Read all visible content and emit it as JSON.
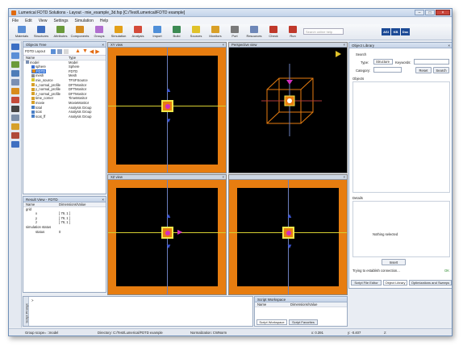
{
  "window": {
    "title": "Lumerical FDTD Solutions - Layout - mie_example_3d.fsp [C:/Test/Lumerical/FDTD example]",
    "controls": [
      "–",
      "□",
      "×"
    ]
  },
  "menu": [
    "File",
    "Edit",
    "View",
    "Settings",
    "Simulation",
    "Help"
  ],
  "toolbar": {
    "buttons": [
      {
        "label": "Materials",
        "icon": "materials-icon",
        "color": "#5b8fd6"
      },
      {
        "label": "Structures",
        "icon": "structures-icon",
        "color": "#3f6fc1"
      },
      {
        "label": "Attributes",
        "icon": "attributes-icon",
        "color": "#6a9a3a"
      },
      {
        "label": "Components",
        "icon": "components-icon",
        "color": "#d38b1f"
      },
      {
        "label": "Groups",
        "icon": "groups-icon",
        "color": "#b06fd0"
      },
      {
        "label": "Simulation",
        "icon": "simulation-icon",
        "color": "#e3a019"
      },
      {
        "label": "Analysis",
        "icon": "analysis-icon",
        "color": "#d44b3a"
      },
      {
        "label": "Import",
        "icon": "import-icon",
        "color": "#4f8fd9"
      },
      {
        "label": "Build",
        "icon": "build-icon",
        "color": "#3d8b54"
      },
      {
        "label": "Sources",
        "icon": "sources-icon",
        "color": "#e0c22a"
      },
      {
        "label": "Monitors",
        "icon": "monitors-icon",
        "color": "#d9a027"
      },
      {
        "label": "Port",
        "icon": "port-icon",
        "color": "#7a7a7a"
      },
      {
        "label": "Resources",
        "icon": "resources-icon",
        "color": "#6e87b8"
      },
      {
        "label": "Check",
        "icon": "check-icon",
        "color": "#c0392b"
      },
      {
        "label": "Run",
        "icon": "run-icon",
        "color": "#c0392b"
      }
    ],
    "search_placeholder": "Search online help",
    "brand": [
      "ASI",
      "KB",
      "Doc"
    ]
  },
  "objects_tree": {
    "title": "Objects Tree",
    "root": "FDTD Layout",
    "headers": [
      "Name",
      "Type"
    ],
    "rows": [
      {
        "name": "model",
        "type": "Model",
        "icon": "#7a8fb3",
        "indent": 0
      },
      {
        "name": "sphere",
        "type": "Sphere",
        "icon": "#3b6fd2",
        "indent": 1
      },
      {
        "name": "FDTD",
        "type": "FDTD",
        "icon": "#e48b16",
        "indent": 1
      },
      {
        "name": "mesh",
        "type": "Mesh",
        "icon": "#8c8c8c",
        "indent": 1
      },
      {
        "name": "mie_source",
        "type": "TFSFSource",
        "icon": "#d6c62a",
        "indent": 1
      },
      {
        "name": "x_normal_profile",
        "type": "DFTMonitor",
        "icon": "#d6a02a",
        "indent": 1
      },
      {
        "name": "y_normal_profile",
        "type": "DFTMonitor",
        "icon": "#d6a02a",
        "indent": 1
      },
      {
        "name": "z_normal_profile",
        "type": "DFTMonitor",
        "icon": "#d6a02a",
        "indent": 1
      },
      {
        "name": "time_corner",
        "type": "TimeMonitor",
        "icon": "#d6a02a",
        "indent": 1
      },
      {
        "name": "movie",
        "type": "MovieMonitor",
        "icon": "#d6a02a",
        "indent": 1
      },
      {
        "name": "total",
        "type": "Analysis Group",
        "icon": "#4a7fc6",
        "indent": 1
      },
      {
        "name": "scat",
        "type": "Analysis Group",
        "icon": "#4a7fc6",
        "indent": 1
      },
      {
        "name": "scat_ff",
        "type": "Analysis Group",
        "icon": "#4a7fc6",
        "indent": 1
      }
    ],
    "selected": "FDTD"
  },
  "result_view": {
    "title": "Result View - FDTD",
    "headers": [
      "Name",
      "Dimensions/Value"
    ],
    "rows": [
      {
        "name": "grid",
        "value": "",
        "indent": 0
      },
      {
        "name": "x",
        "value": "[ 79, 1 ]",
        "indent": 2
      },
      {
        "name": "y",
        "value": "[ 79, 1 ]",
        "indent": 2
      },
      {
        "name": "z",
        "value": "[ 79, 1 ]",
        "indent": 2
      },
      {
        "name": "simulation status",
        "value": "",
        "indent": 0
      },
      {
        "name": "status",
        "value": "0",
        "indent": 2
      }
    ]
  },
  "views": {
    "xy": "XY view",
    "perspective": "Perspective view",
    "xz": "XZ view",
    "yz": ""
  },
  "object_library": {
    "title": "Object Library",
    "search_label": "Search",
    "type_label": "Type:",
    "type_value": "Structure",
    "keywords_label": "Keywords:",
    "category_label": "Category:",
    "reset": "Reset",
    "search_btn": "Search",
    "objects_label": "Objects",
    "details_label": "Details",
    "nothing_selected": "Nothing selected",
    "insert": "Insert",
    "status": "Trying to establish connection...",
    "status_ok": "OK",
    "tabs": [
      "Script File Editor",
      "Object Library",
      "Optimizations and Sweeps"
    ]
  },
  "script_workspace": {
    "title": "Script Workspace",
    "headers": [
      "Name",
      "Dimensions/Value"
    ],
    "tabs": [
      "Script Workspace",
      "Script Favorites"
    ]
  },
  "script_prompt": {
    "side_label": "Script Prompt",
    "prompt": ">"
  },
  "statusbar": {
    "group_scope": "Group scope= ::model",
    "directory": "Directory: C:/Test/Lumerical/FDTD example",
    "normalization": "Normalization: CWNorm",
    "x": "x: 0.391",
    "y": "y: -0.407",
    "z": "z:"
  }
}
